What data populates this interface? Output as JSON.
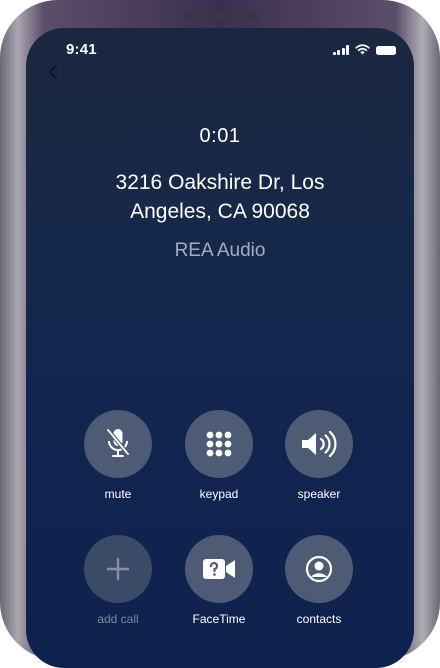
{
  "status_bar": {
    "time": "9:41"
  },
  "call": {
    "timer": "0:01",
    "address_line1": "3216 Oakshire Dr, Los",
    "address_line2": "Angeles, CA 90068",
    "source": "REA Audio"
  },
  "controls": {
    "mute": {
      "label": "mute",
      "icon": "mic-off-icon"
    },
    "keypad": {
      "label": "keypad",
      "icon": "keypad-icon"
    },
    "speaker": {
      "label": "speaker",
      "icon": "speaker-icon"
    },
    "add_call": {
      "label": "add call",
      "icon": "plus-icon"
    },
    "facetime": {
      "label": "FaceTime",
      "icon": "video-icon"
    },
    "contacts": {
      "label": "contacts",
      "icon": "contact-icon"
    }
  },
  "colors": {
    "screen_top": "#1a2740",
    "screen_bottom": "#0e224e",
    "button": "#4d5b75"
  }
}
